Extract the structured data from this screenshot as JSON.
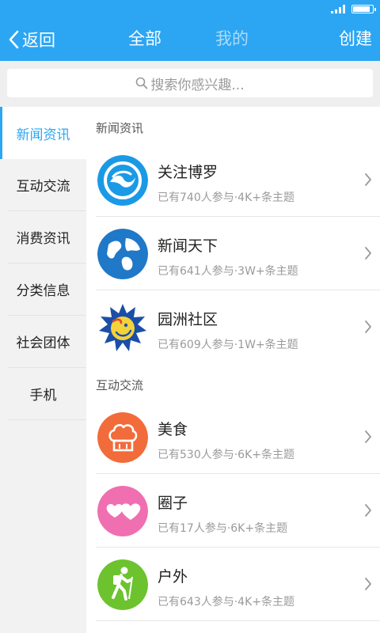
{
  "nav": {
    "back_label": "返回",
    "tab_all": "全部",
    "tab_mine": "我的",
    "create_label": "创建"
  },
  "search": {
    "placeholder": "搜索你感兴趣..."
  },
  "sidebar": {
    "items": [
      {
        "label": "新闻资讯"
      },
      {
        "label": "互动交流"
      },
      {
        "label": "消费资讯"
      },
      {
        "label": "分类信息"
      },
      {
        "label": "社会团体"
      },
      {
        "label": "手机"
      }
    ]
  },
  "sections": [
    {
      "title": "新闻资讯",
      "items": [
        {
          "name": "关注博罗",
          "meta": "已有740人参与·4K+条主题",
          "icon": "wave-logo-icon"
        },
        {
          "name": "新闻天下",
          "meta": "已有641人参与·3W+条主题",
          "icon": "globe-icon"
        },
        {
          "name": "园洲社区",
          "meta": "已有609人参与·1W+条主题",
          "icon": "sun-face-icon"
        }
      ]
    },
    {
      "title": "互动交流",
      "items": [
        {
          "name": "美食",
          "meta": "已有530人参与·6K+条主题",
          "icon": "chef-hat-icon"
        },
        {
          "name": "圈子",
          "meta": "已有17人参与·6K+条主题",
          "icon": "hearts-icon"
        },
        {
          "name": "户外",
          "meta": "已有643人参与·4K+条主题",
          "icon": "hiker-icon"
        }
      ]
    }
  ],
  "colors": {
    "accent": "#2ca6f3",
    "battery": "#ffffff"
  },
  "status": {
    "battery_level": 0.9
  }
}
